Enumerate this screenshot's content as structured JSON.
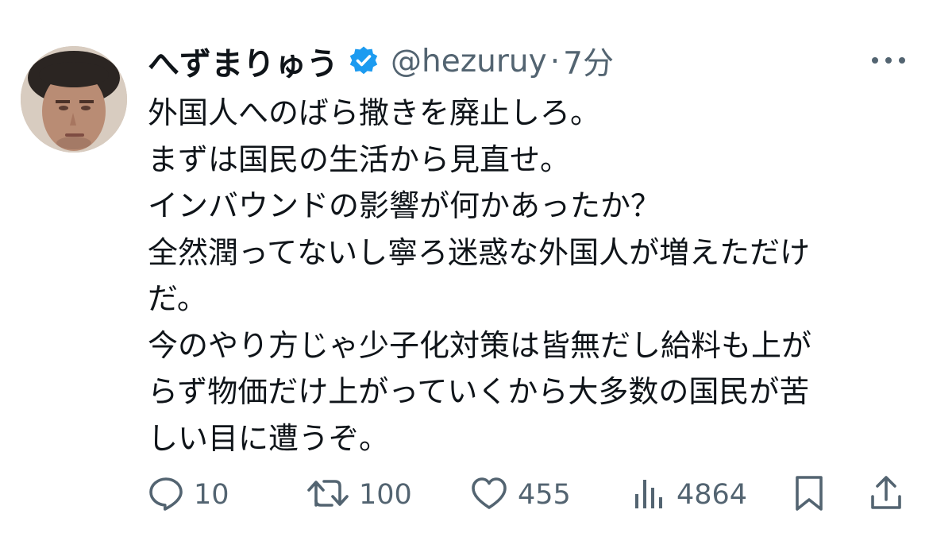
{
  "tweet": {
    "author": {
      "display_name": "へずまりゅう",
      "handle": "@hezuruy",
      "verified": true
    },
    "separator": "·",
    "time": "7分",
    "lines": [
      "外国人へのばら撒きを廃止しろ。",
      "まずは国民の生活から見直せ。",
      "インバウンドの影響が何かあったか？",
      "全然潤ってないし寧ろ迷惑な外国人が増えただけ",
      "だ。",
      "今のやり方じゃ少子化対策は皆無だし給料も上が",
      "らず物価だけ上がっていくから大多数の国民が苦",
      "しい目に遭うぞ。"
    ]
  },
  "actions": {
    "replies": "10",
    "retweets": "100",
    "likes": "455",
    "views": "4864"
  },
  "icons": {
    "reply": "reply-icon",
    "retweet": "retweet-icon",
    "like": "heart-icon",
    "views": "views-icon",
    "bookmark": "bookmark-icon",
    "share": "share-icon",
    "more": "more-icon",
    "verified": "verified-badge-icon"
  },
  "colors": {
    "text": "#0f1419",
    "muted": "#536471",
    "verified": "#1d9bf0"
  }
}
